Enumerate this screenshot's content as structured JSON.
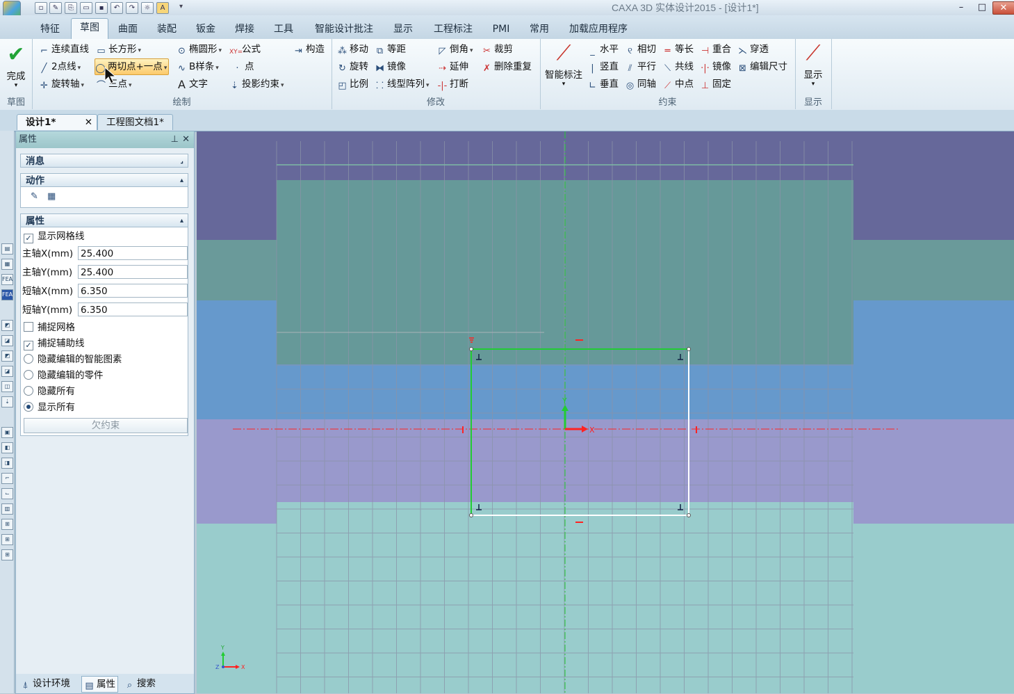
{
  "window": {
    "title": "CAXA 3D 实体设计2015 - [设计1*]"
  },
  "quick_access": [
    "new",
    "save",
    "open",
    "folder",
    "disk",
    "undo",
    "redo",
    "settings",
    "library",
    "dropdown"
  ],
  "ribbon_tabs": [
    "特征",
    "草图",
    "曲面",
    "装配",
    "钣金",
    "焊接",
    "工具",
    "智能设计批注",
    "显示",
    "工程标注",
    "PMI",
    "常用",
    "加载应用程序"
  ],
  "active_tab": "草图",
  "ribbon": {
    "sketch_group": {
      "finish": "完成",
      "label": "草图"
    },
    "draw_group": {
      "label": "绘制",
      "items": [
        "连续直线",
        "长方形",
        "椭圆形",
        "公式",
        "构造",
        "2点线",
        "两切点+一点",
        "B样条",
        "点",
        "旋转轴",
        "三点",
        "文字",
        "投影约束"
      ]
    },
    "modify_group": {
      "label": "修改",
      "items": [
        "移动",
        "等距",
        "倒角",
        "裁剪",
        "旋转",
        "镜像",
        "延伸",
        "删除重复",
        "比例",
        "线型阵列",
        "打断"
      ]
    },
    "constraint_group": {
      "label": "约束",
      "smart_dim": "智能标注",
      "items": [
        "水平",
        "相切",
        "等长",
        "重合",
        "穿透",
        "竖直",
        "平行",
        "共线",
        "镜像",
        "编辑尺寸",
        "垂直",
        "同轴",
        "中点",
        "固定"
      ]
    },
    "display_group": {
      "button": "显示",
      "label": "显示"
    }
  },
  "doc_tabs": [
    {
      "label": "设计1*",
      "active": true
    },
    {
      "label": "工程图文档1*",
      "active": false
    }
  ],
  "panel": {
    "title": "属性",
    "sections": {
      "message": "消息",
      "action": "动作",
      "properties": "属性"
    },
    "show_grid": "显示网格线",
    "fields": [
      {
        "label": "主轴X(mm)",
        "value": "25.400"
      },
      {
        "label": "主轴Y(mm)",
        "value": "25.400"
      },
      {
        "label": "短轴X(mm)",
        "value": "6.350"
      },
      {
        "label": "短轴Y(mm)",
        "value": "6.350"
      }
    ],
    "snap_grid": "捕捉网格",
    "snap_aux": "捕捉辅助线",
    "radios": [
      "隐藏编辑的智能图素",
      "隐藏编辑的零件",
      "隐藏所有",
      "显示所有"
    ],
    "radio_selected": "显示所有",
    "status_button": "欠约束",
    "bottom_tabs": [
      "设计环境",
      "属性",
      "搜索"
    ]
  },
  "canvas": {
    "axis_x": "X",
    "axis_y": "Y",
    "triad_y": "Y",
    "triad_z": "Z",
    "triad_x": "X"
  },
  "colors": {
    "constraint_green": "#22cc33",
    "axis_red": "#ff2222",
    "sketch_white": "#ffffff"
  }
}
